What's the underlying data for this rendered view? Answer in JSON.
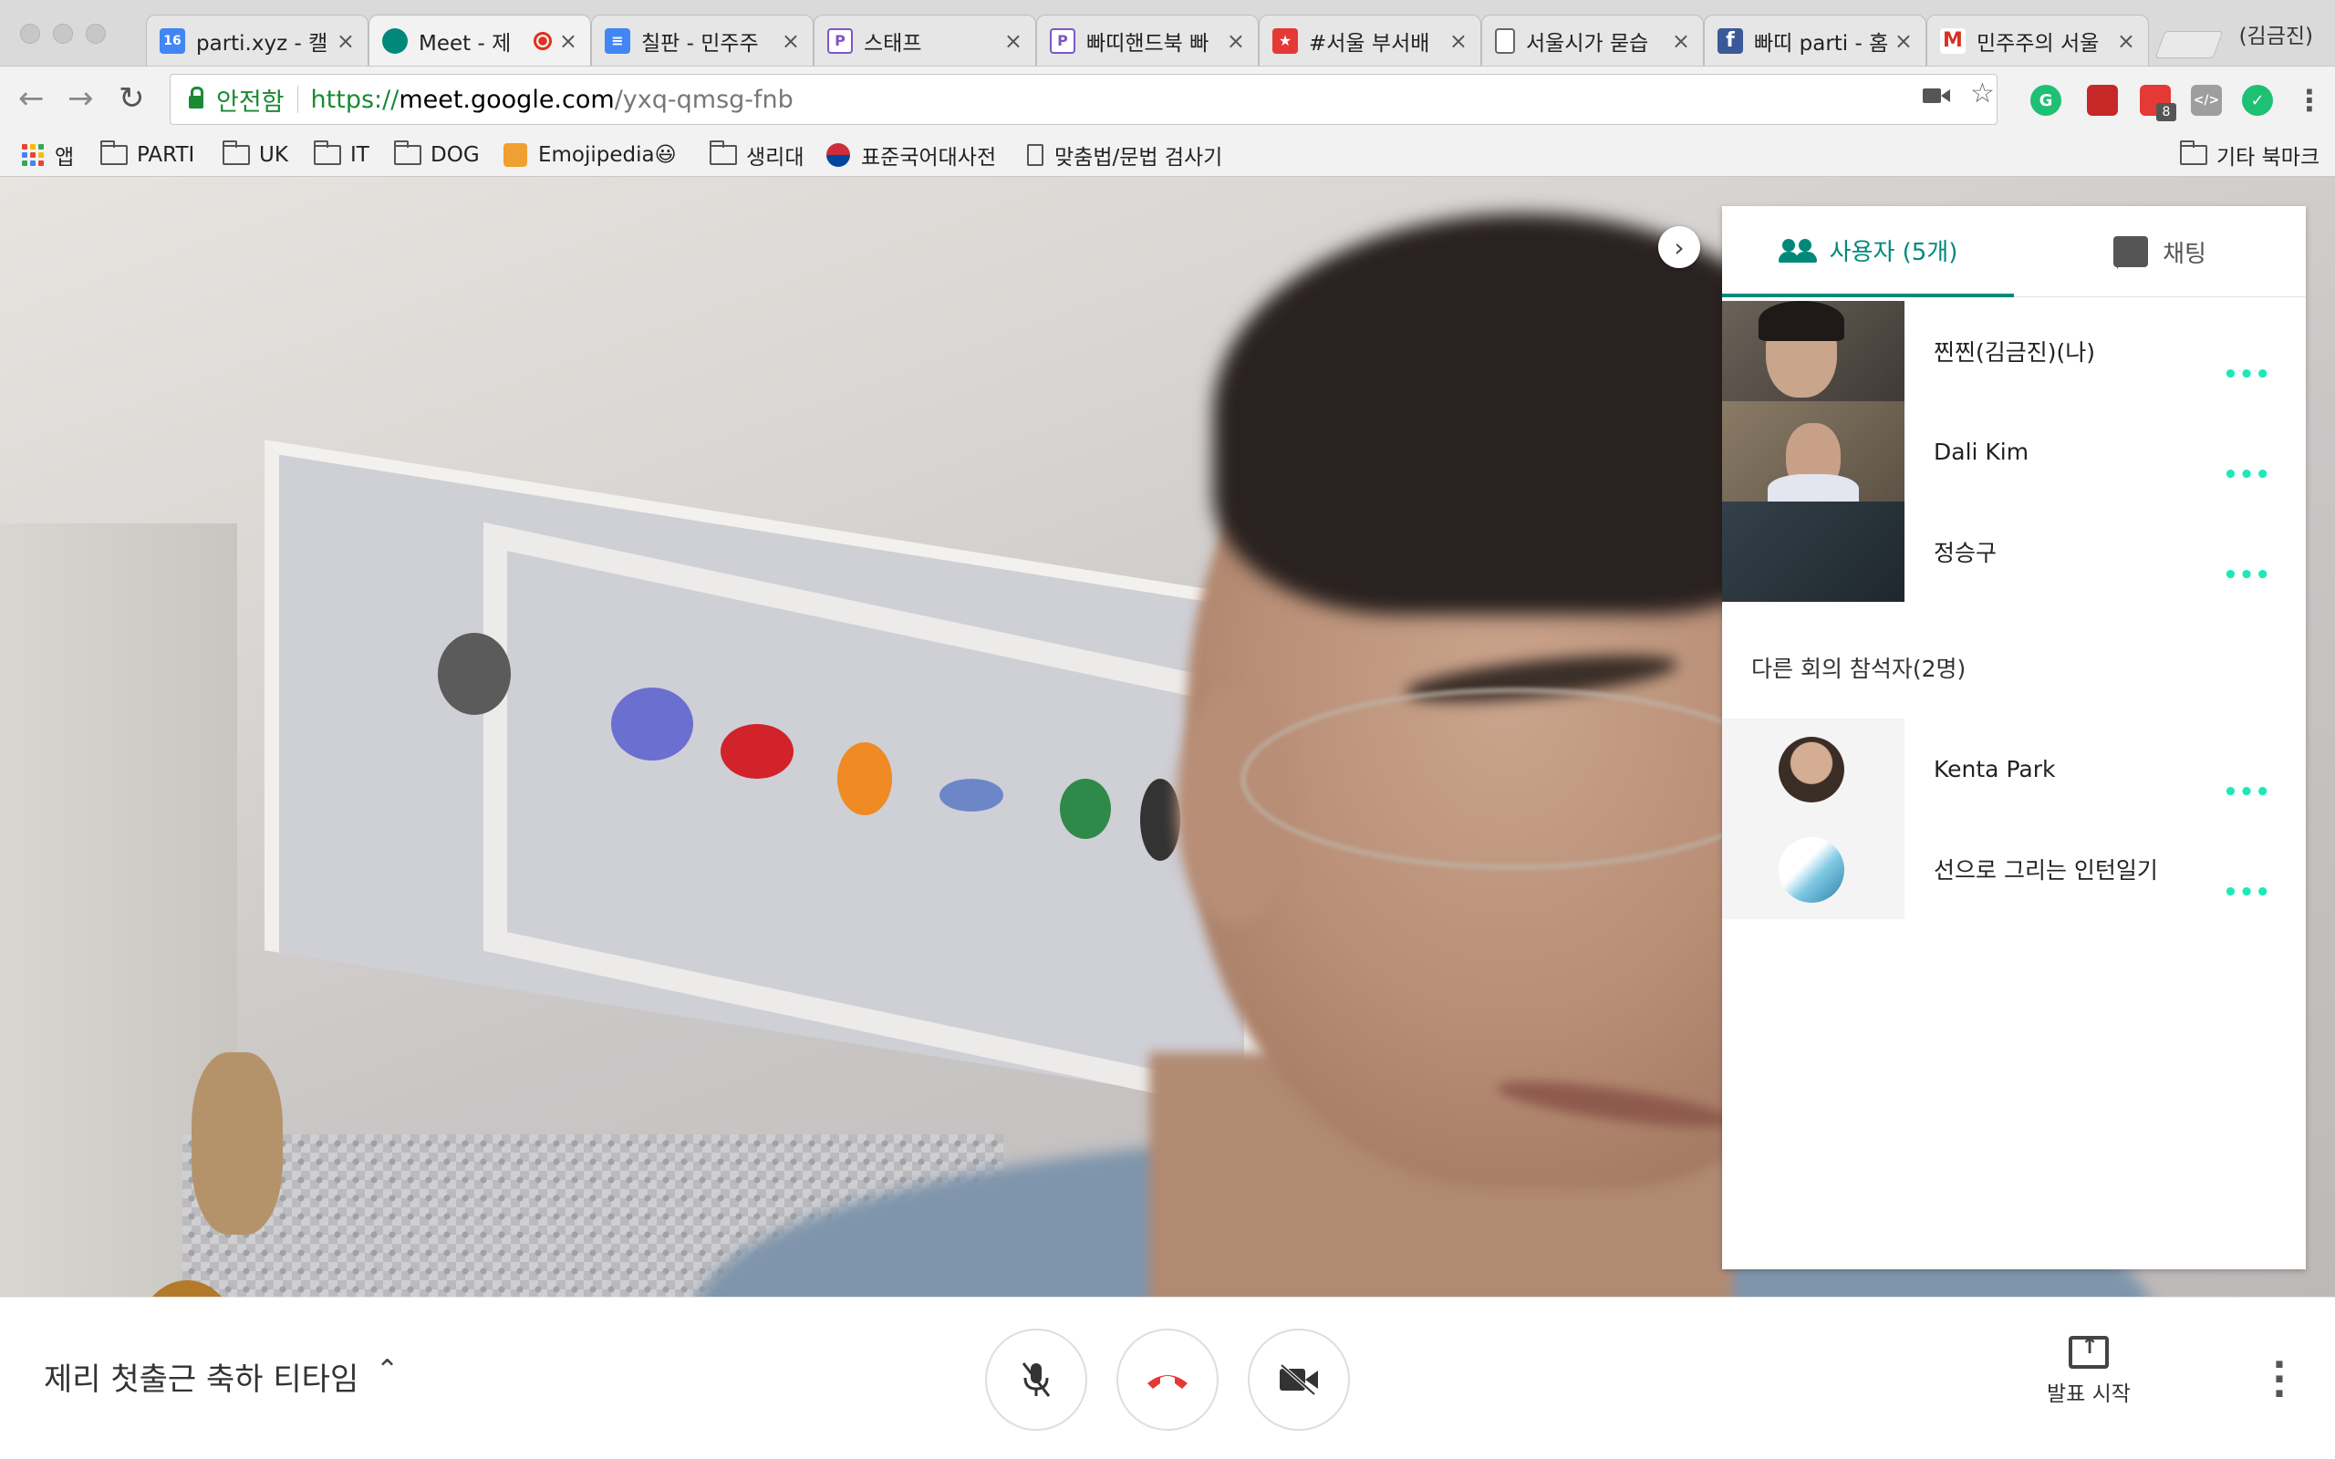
{
  "browser": {
    "tabs": [
      {
        "title": "parti.xyz - 캘",
        "favicon": "calendar-16-icon",
        "fav_text": "16",
        "color": "#4285f4"
      },
      {
        "title": "Meet - 제",
        "favicon": "meet-icon",
        "fav_text": "",
        "color": "#00897b",
        "recording": true
      },
      {
        "title": "칠판 - 민주주",
        "favicon": "docs-icon",
        "fav_text": "≡",
        "color": "#4285f4"
      },
      {
        "title": "스태프",
        "favicon": "parti-p-icon",
        "fav_text": "P",
        "color": "#7e57c2"
      },
      {
        "title": "빠띠핸드북 빠",
        "favicon": "parti-p-icon",
        "fav_text": "P",
        "color": "#7e57c2"
      },
      {
        "title": "#서울 부서배",
        "favicon": "star-icon",
        "fav_text": "★",
        "color": "#e53935"
      },
      {
        "title": "서울시가 묻습",
        "favicon": "page-icon",
        "fav_text": "",
        "color": "#ffffff"
      },
      {
        "title": "빠띠 parti - 홈",
        "favicon": "facebook-icon",
        "fav_text": "f",
        "color": "#3b5998"
      },
      {
        "title": "민주주의 서울",
        "favicon": "gmail-icon",
        "fav_text": "M",
        "color": "#ffffff"
      }
    ],
    "profile": "(김금진)",
    "secure_label": "안전함",
    "url": {
      "scheme": "https://",
      "host": "meet.google.com",
      "path": "/yxq-qmsg-fnb"
    },
    "extension_badge": "8"
  },
  "bookmarks": {
    "items": [
      {
        "label": "앱",
        "type": "apps"
      },
      {
        "label": "PARTI",
        "type": "folder"
      },
      {
        "label": "UK",
        "type": "folder"
      },
      {
        "label": "IT",
        "type": "folder"
      },
      {
        "label": "DOG",
        "type": "folder"
      },
      {
        "label": "Emojipedia😃",
        "type": "site"
      },
      {
        "label": "생리대",
        "type": "folder"
      },
      {
        "label": "표준국어대사전",
        "type": "site"
      },
      {
        "label": "맞춤법/문법 검사기",
        "type": "page"
      }
    ],
    "other": "기타 북마크"
  },
  "panel": {
    "tabs": {
      "people": "사용자 (5개)",
      "chat": "채팅"
    },
    "participants": [
      {
        "name": "찐찐(김금진)(나)"
      },
      {
        "name": "Dali Kim"
      },
      {
        "name": "정승구"
      }
    ],
    "others_label": "다른 회의 참석자(2명)",
    "others": [
      {
        "name": "Kenta Park"
      },
      {
        "name": "선으로 그리는 인턴일기"
      }
    ],
    "more_dots": "•••"
  },
  "meeting": {
    "title": "제리 첫출근 축하 티타임",
    "present_label": "발표 시작"
  },
  "colors": {
    "accent": "#00897b",
    "hangup": "#e53935",
    "secure": "#1a8a35"
  }
}
